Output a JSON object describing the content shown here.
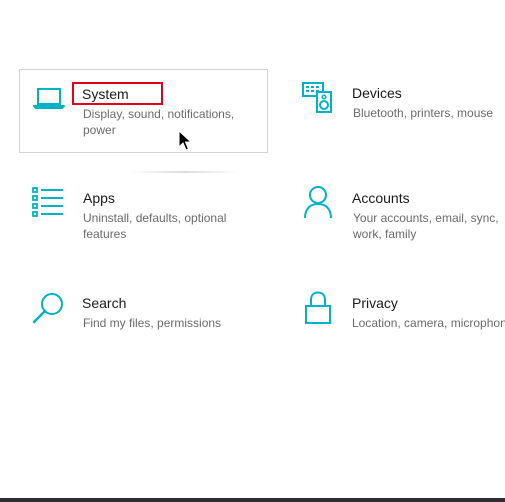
{
  "accent_color": "#00b2c6",
  "highlight_color": "#e0001b",
  "tiles": {
    "system": {
      "title": "System",
      "desc_line1": "Display, sound, notifications,",
      "desc_line2": "power",
      "icon": "laptop-icon"
    },
    "devices": {
      "title": "Devices",
      "desc_line1": "Bluetooth, printers, mouse",
      "icon": "keyboard-speaker-icon"
    },
    "apps": {
      "title": "Apps",
      "desc_line1": "Uninstall, defaults, optional",
      "desc_line2": "features",
      "icon": "apps-list-icon"
    },
    "accounts": {
      "title": "Accounts",
      "desc_line1": "Your accounts, email, sync,",
      "desc_line2": "work, family",
      "icon": "person-icon"
    },
    "search": {
      "title": "Search",
      "desc_line1": "Find my files, permissions",
      "icon": "search-icon"
    },
    "privacy": {
      "title": "Privacy",
      "desc_line1": "Location, camera, microphone",
      "icon": "lock-icon"
    }
  }
}
